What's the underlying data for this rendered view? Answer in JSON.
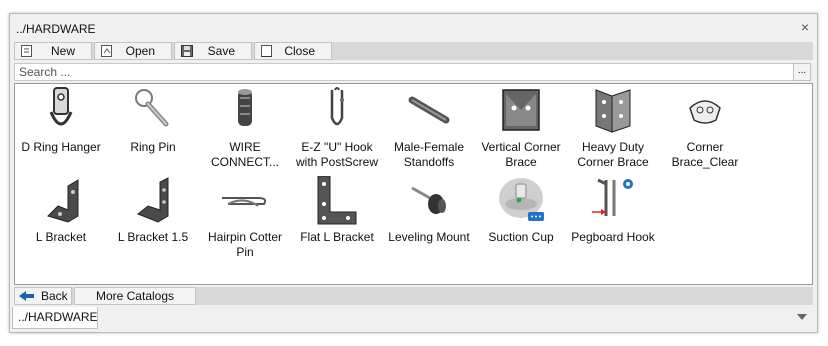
{
  "window": {
    "title": "../HARDWARE",
    "close_glyph": "×"
  },
  "toolbar": [
    {
      "label": "New",
      "icon": "new-document-icon"
    },
    {
      "label": "Open",
      "icon": "open-document-icon"
    },
    {
      "label": "Save",
      "icon": "save-disk-icon"
    },
    {
      "label": "Close",
      "icon": "close-document-icon"
    }
  ],
  "search": {
    "placeholder": "Search ...",
    "browse_label": "..."
  },
  "items": [
    {
      "name": "D Ring Hanger",
      "lines": [
        "D Ring Hanger"
      ]
    },
    {
      "name": "Ring Pin",
      "lines": [
        "Ring Pin"
      ]
    },
    {
      "name": "WIRE CONNECT...",
      "lines": [
        "WIRE",
        "CONNECT..."
      ]
    },
    {
      "name": "E-Z \"U\" Hook with PostScrew",
      "lines": [
        "E-Z \"U\" Hook",
        "with PostScrew"
      ]
    },
    {
      "name": "Male-Female Standoffs",
      "lines": [
        "Male-Female",
        "Standoffs"
      ]
    },
    {
      "name": "Vertical Corner Brace",
      "lines": [
        "Vertical Corner",
        "Brace"
      ]
    },
    {
      "name": "Heavy Duty Corner Brace",
      "lines": [
        "Heavy Duty",
        "Corner Brace"
      ]
    },
    {
      "name": "Corner Brace_Clear",
      "lines": [
        "Corner",
        "Brace_Clear"
      ]
    },
    {
      "name": "L Bracket",
      "lines": [
        "L Bracket"
      ]
    },
    {
      "name": "L Bracket 1.5",
      "lines": [
        "L Bracket 1.5"
      ]
    },
    {
      "name": "Hairpin Cotter Pin",
      "lines": [
        "Hairpin Cotter",
        "Pin"
      ]
    },
    {
      "name": "Flat L Bracket",
      "lines": [
        "Flat L Bracket"
      ]
    },
    {
      "name": "Leveling Mount",
      "lines": [
        "Leveling Mount"
      ]
    },
    {
      "name": "Suction Cup",
      "lines": [
        "Suction Cup"
      ]
    },
    {
      "name": "Pegboard Hook",
      "lines": [
        "Pegboard Hook"
      ]
    }
  ],
  "bottom": {
    "back_label": "Back",
    "more_label": "More Catalogs"
  },
  "tab": {
    "label": "../HARDWARE"
  },
  "colors": {
    "back_arrow": "#1f5fa8",
    "accent_blue": "#1e73c8",
    "thumb_gray": "#555555"
  }
}
